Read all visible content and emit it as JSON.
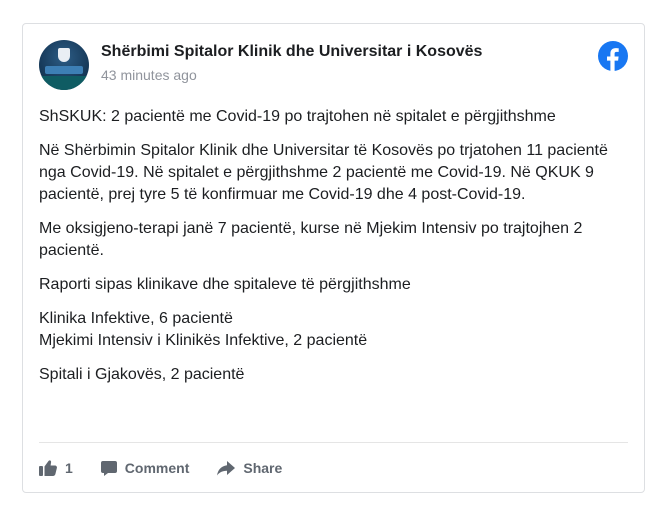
{
  "post": {
    "page_name": "Shërbimi Spitalor Klinik dhe Universitar i Kosovës",
    "timestamp": "43 minutes ago",
    "paragraphs": [
      "ShSKUK: 2 pacientë me Covid-19 po trajtohen në spitalet e përgjithshme",
      "Në Shërbimin Spitalor Klinik dhe Universitar të Kosovës po trjatohen 11 pacientë nga Covid-19. Në spitalet e përgjithshme 2 pacientë me Covid-19. Në QKUK 9 pacientë, prej tyre 5 të konfirmuar me Covid-19 dhe 4 post-Covid-19.",
      "Me oksigjeno-terapi janë 7 pacientë, kurse në Mjekim Intensiv po trajtojhen 2 pacientë.",
      "Raporti sipas klinikave dhe spitaleve të përgjithshme",
      "Klinika Infektive, 6 pacientë",
      "Mjekimi Intensiv i Klinikës Infektive, 2 pacientë",
      "Spitali i Gjakovës, 2 pacientë"
    ]
  },
  "actions": {
    "like_count": "1",
    "comment_label": "Comment",
    "share_label": "Share"
  },
  "icons": {
    "brand": "facebook-icon",
    "like": "thumbs-up-icon",
    "comment": "comment-icon",
    "share": "share-icon"
  },
  "colors": {
    "facebook_blue": "#1877f2",
    "action_grey": "#606770",
    "timestamp_grey": "#90949c"
  }
}
